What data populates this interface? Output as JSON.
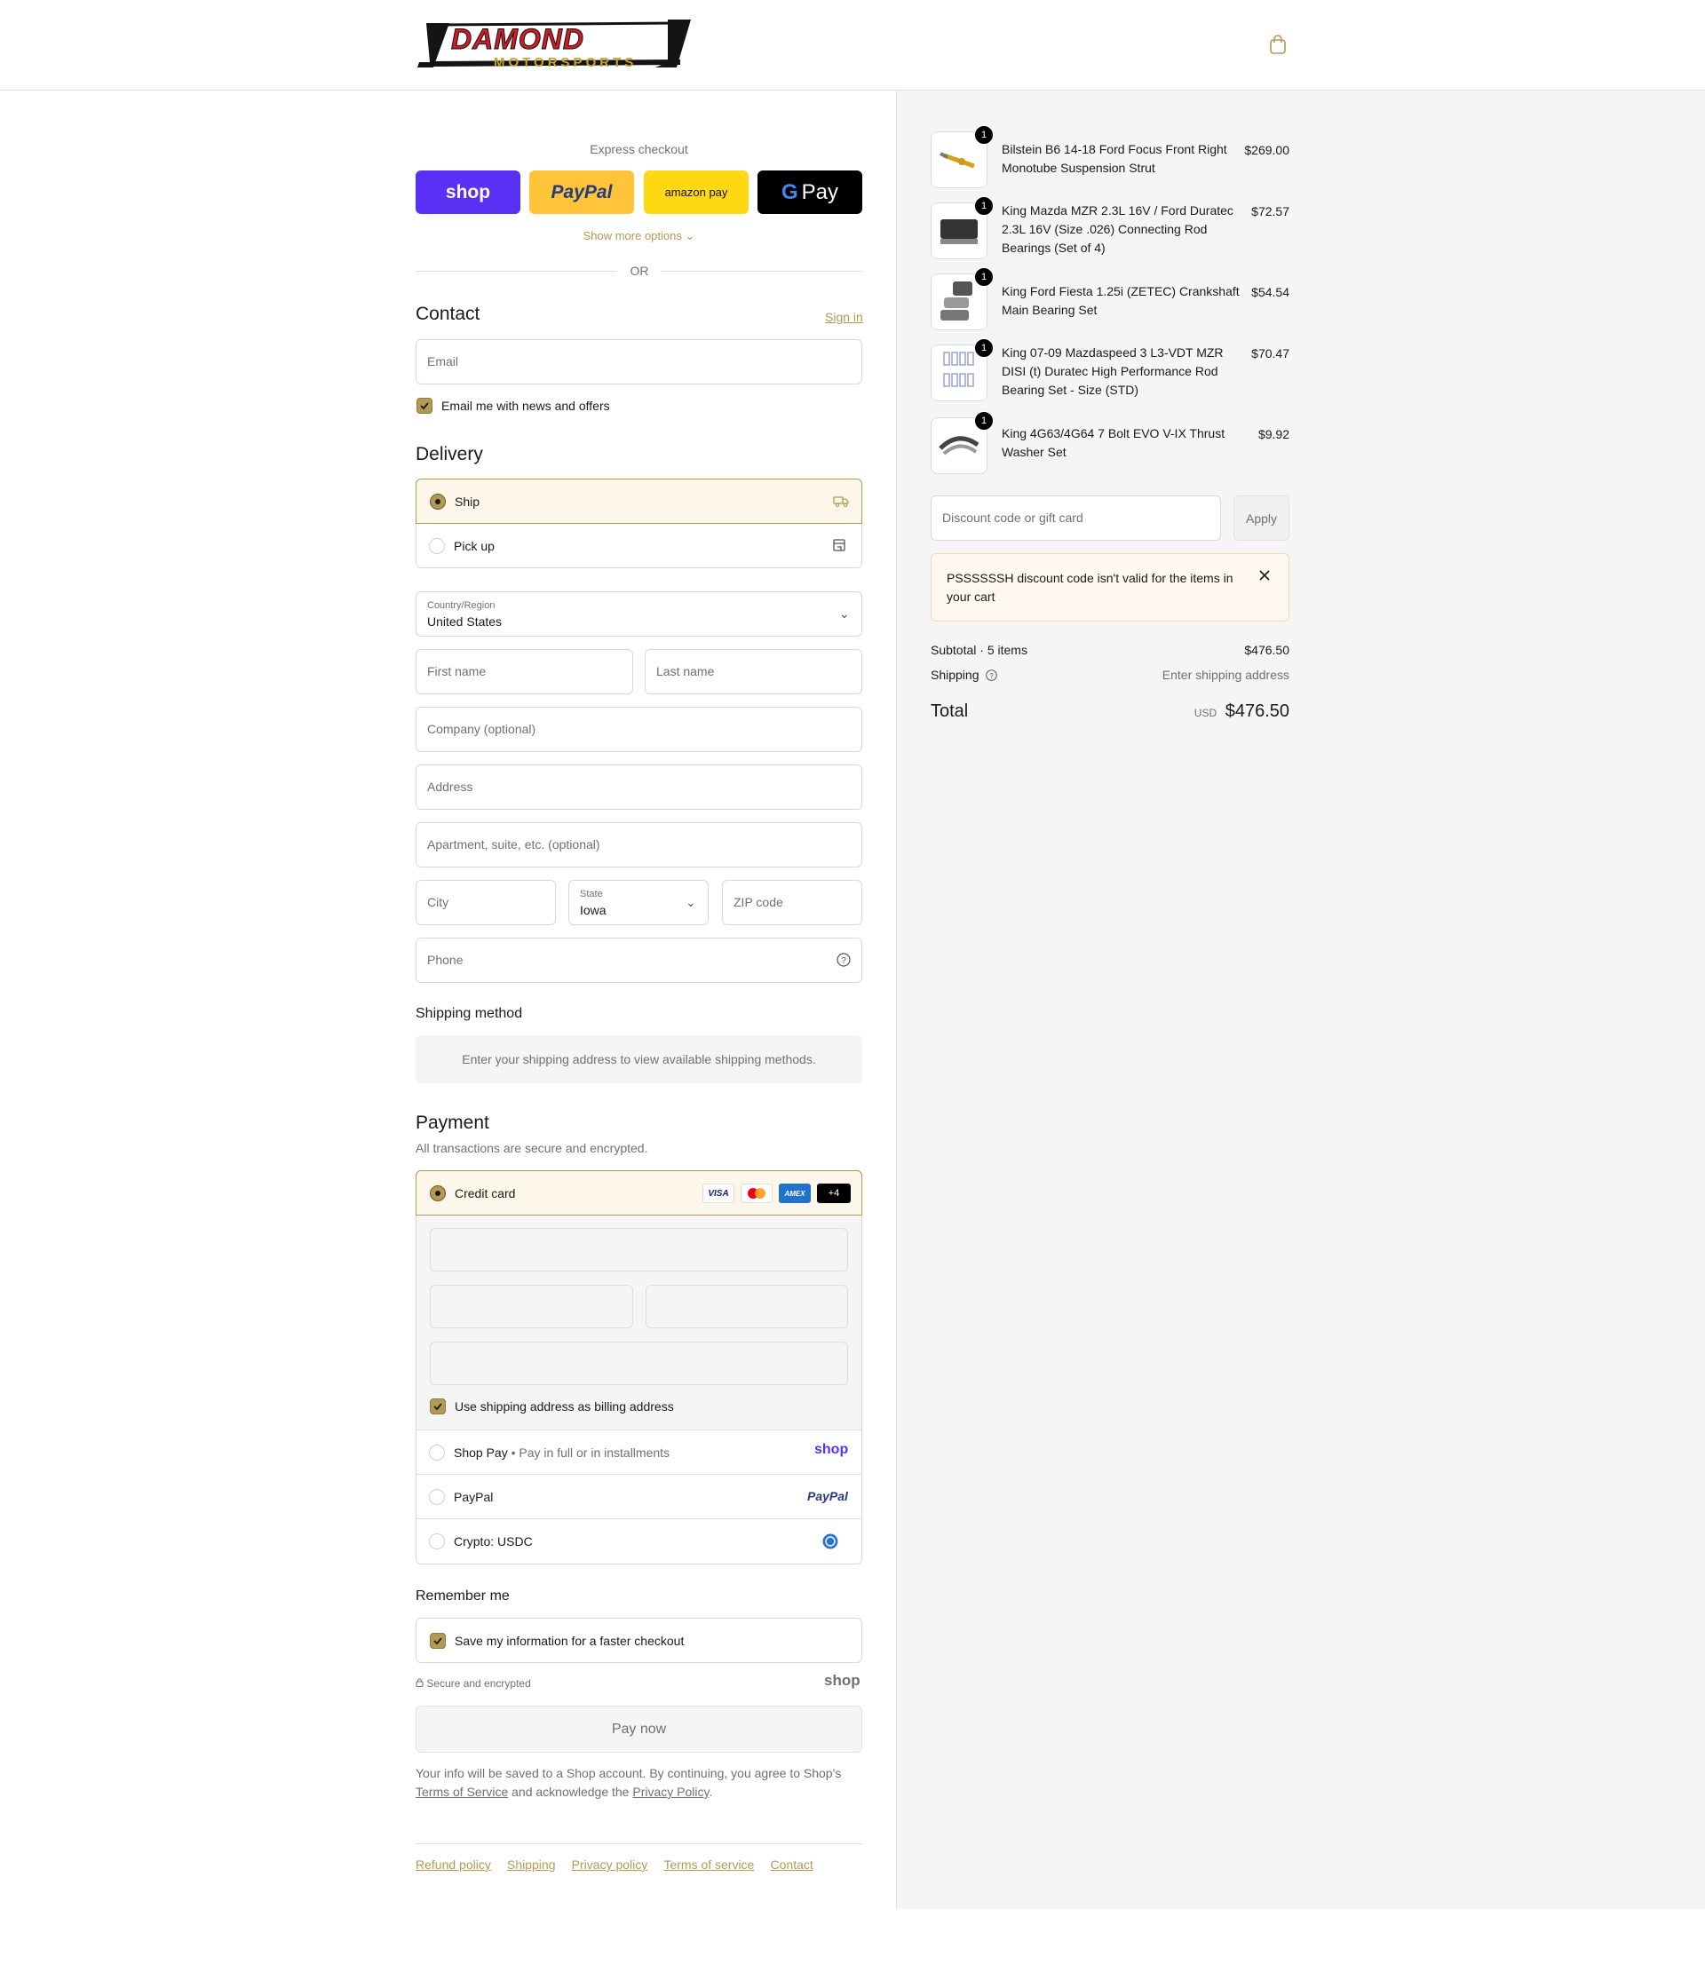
{
  "header": {
    "brand_top": "DAMOND",
    "brand_bottom": "MOTORSPORTS"
  },
  "express": {
    "title": "Express checkout",
    "shop_label": "shop",
    "paypal_label": "PayPal",
    "amazon_label": "amazon pay",
    "gpay_label": "Pay",
    "more_options": "Show more options",
    "or": "OR"
  },
  "contact": {
    "heading": "Contact",
    "sign_in": "Sign in",
    "email_placeholder": "Email",
    "news_label": "Email me with news and offers"
  },
  "delivery": {
    "heading": "Delivery",
    "ship_label": "Ship",
    "pickup_label": "Pick up",
    "country_label": "Country/Region",
    "country_value": "United States",
    "first_name": "First name",
    "last_name": "Last name",
    "company": "Company (optional)",
    "address": "Address",
    "apartment": "Apartment, suite, etc. (optional)",
    "city": "City",
    "state_label": "State",
    "state_value": "Iowa",
    "zip": "ZIP code",
    "phone": "Phone"
  },
  "shipping_method": {
    "heading": "Shipping method",
    "notice": "Enter your shipping address to view available shipping methods."
  },
  "payment": {
    "heading": "Payment",
    "subtitle": "All transactions are secure and encrypted.",
    "credit_card": "Credit card",
    "cards": [
      "VISA",
      "MC",
      "AMEX",
      "+4"
    ],
    "billing_same": "Use shipping address as billing address",
    "shop_pay": "Shop Pay",
    "shop_pay_note": "Pay in full or in installments",
    "shop_logo": "shop",
    "paypal": "PayPal",
    "paypal_logo": "PayPal",
    "crypto": "Crypto: USDC"
  },
  "remember": {
    "heading": "Remember me",
    "save_label": "Save my information for a faster checkout",
    "secure_label": "Secure and encrypted",
    "shop_logo": "shop"
  },
  "pay_now": "Pay now",
  "legal": {
    "line1": "Your info will be saved to a Shop account. By continuing, you agree to Shop's",
    "terms": "Terms of Service",
    "middle": "and acknowledge the",
    "privacy": "Privacy Policy",
    "end": "."
  },
  "footer_links": [
    "Refund policy",
    "Shipping",
    "Privacy policy",
    "Terms of service",
    "Contact"
  ],
  "cart": {
    "items": [
      {
        "qty": "1",
        "name": "Bilstein B6 14-18 Ford Focus Front Right Monotube Suspension Strut",
        "price": "$269.00"
      },
      {
        "qty": "1",
        "name": "King Mazda MZR 2.3L 16V / Ford Duratec 2.3L 16V (Size .026) Connecting Rod Bearings (Set of 4)",
        "price": "$72.57"
      },
      {
        "qty": "1",
        "name": "King Ford Fiesta 1.25i (ZETEC) Crankshaft Main Bearing Set",
        "price": "$54.54"
      },
      {
        "qty": "1",
        "name": "King 07-09 Mazdaspeed 3 L3-VDT MZR DISI (t) Duratec High Performance Rod Bearing Set - Size (STD)",
        "price": "$70.47"
      },
      {
        "qty": "1",
        "name": "King 4G63/4G64 7 Bolt EVO V-IX Thrust Washer Set",
        "price": "$9.92"
      }
    ],
    "discount_placeholder": "Discount code or gift card",
    "apply": "Apply",
    "error": "PSSSSSSH discount code isn't valid for the items in your cart",
    "subtotal_label": "Subtotal · 5 items",
    "subtotal_value": "$476.50",
    "shipping_label": "Shipping",
    "shipping_value": "Enter shipping address",
    "total_label": "Total",
    "currency": "USD",
    "total_value": "$476.50"
  },
  "colors": {
    "accent": "#b29a55",
    "shop": "#5a31f4",
    "paypal": "#ffc439",
    "amazon": "#ffd814",
    "error_bg": "#fff8ef"
  }
}
